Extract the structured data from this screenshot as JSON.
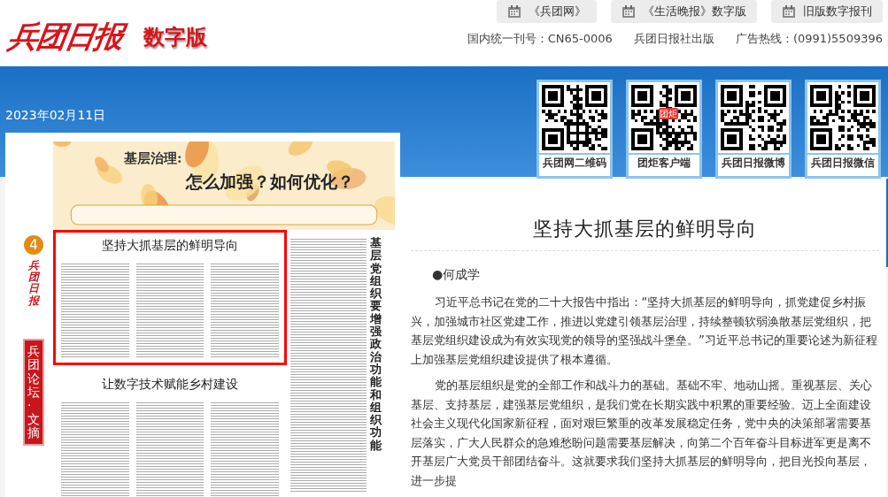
{
  "logo": {
    "title": "兵团日报",
    "subtitle": "数字版"
  },
  "top_links": [
    {
      "label": "《兵团网》"
    },
    {
      "label": "《生活晚报》数字版"
    },
    {
      "label": "旧版数字报刊"
    }
  ],
  "info": [
    "国内统一刊号：CN65-0006",
    "兵团日报社出版",
    "广告热线：(0991)5509396"
  ],
  "date": "2023年02月11日",
  "qr_codes": [
    {
      "caption": "兵团网二维码"
    },
    {
      "caption": "团炬客户端",
      "center_badge": "团炬"
    },
    {
      "caption": "兵团日报微博"
    },
    {
      "caption": "兵团日报微信"
    }
  ],
  "newspaper_page": {
    "page_number": "4",
    "masthead": "兵团日报",
    "section": "兵团论坛·文摘",
    "banner_kicker": "基层治理:",
    "banner_title": "怎么加强？如何优化？",
    "articles": [
      {
        "headline": "坚持大抓基层的鲜明导向",
        "selected": true
      },
      {
        "headline": "让数字技术赋能乡村建设",
        "selected": false
      }
    ],
    "side_headline": "基层党组织要增强政治功能和组织功能"
  },
  "article": {
    "title": "坚持大抓基层的鲜明导向",
    "byline": "●何成学",
    "paragraphs": [
      "习近平总书记在党的二十大报告中指出：“坚持大抓基层的鲜明导向，抓党建促乡村振兴，加强城市社区党建工作，推进以党建引领基层治理，持续整顿软弱涣散基层党组织，把基层党组织建设成为有效实现党的领导的坚强战斗堡垒。”习近平总书记的重要论述为新征程上加强基层党组织建设提供了根本遵循。",
      "党的基层组织是党的全部工作和战斗力的基础。基础不牢、地动山摇。重视基层、关心基层、支持基层，建强基层党组织，是我们党在长期实践中积累的重要经验。迈上全面建设社会主义现代化国家新征程，面对艰巨繁重的改革发展稳定任务，党中央的决策部署需要基层落实，广大人民群众的急难愁盼问题需要基层解决，向第二个百年奋斗目标进军更是离不开基层广大党员干部团结奋斗。这就要求我们坚持大抓基层的鲜明导向，把目光投向基层，进一步提"
    ]
  }
}
